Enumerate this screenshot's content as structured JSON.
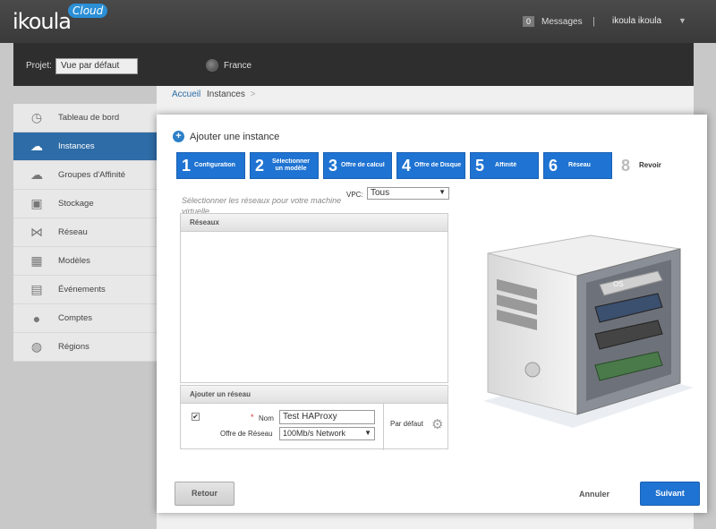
{
  "header": {
    "logo_text": "ikoula",
    "logo_cloud": "Cloud",
    "messages_count": "0",
    "messages_label": "Messages",
    "separator": "|",
    "user": "ikoula ikoula"
  },
  "project": {
    "label": "Projet:",
    "selected": "Vue par défaut",
    "zone": "France"
  },
  "breadcrumb": {
    "home": "Accueil",
    "current": "Instances",
    "arrow": ">"
  },
  "sidebar": {
    "items": [
      {
        "label": "Tableau de bord",
        "icon": "dashboard-icon"
      },
      {
        "label": "Instances",
        "icon": "cloud-icon",
        "active": true
      },
      {
        "label": "Groupes d'Affinité",
        "icon": "affinity-icon"
      },
      {
        "label": "Stockage",
        "icon": "storage-icon"
      },
      {
        "label": "Réseau",
        "icon": "network-icon"
      },
      {
        "label": "Modèles",
        "icon": "templates-icon"
      },
      {
        "label": "Événements",
        "icon": "calendar-icon"
      },
      {
        "label": "Comptes",
        "icon": "user-icon"
      },
      {
        "label": "Régions",
        "icon": "globe-icon"
      }
    ]
  },
  "modal": {
    "title": "Ajouter une instance",
    "steps": [
      {
        "num": "1",
        "label": "Configuration",
        "active": true
      },
      {
        "num": "2",
        "label": "Sélectionner un modèle",
        "active": true
      },
      {
        "num": "3",
        "label": "Offre de calcul",
        "active": true
      },
      {
        "num": "4",
        "label": "Offre de Disque",
        "active": true
      },
      {
        "num": "5",
        "label": "Affinité",
        "active": true
      },
      {
        "num": "6",
        "label": "Réseau",
        "active": true
      },
      {
        "num": "8",
        "label": "Revoir",
        "active": false
      }
    ],
    "network_hint": "Sélectionner les réseaux pour votre machine virtuelle",
    "vpc_label": "VPC:",
    "vpc_value": "Tous",
    "networks_header": "Réseaux",
    "add_network_header": "Ajouter un réseau",
    "name_required": "*",
    "name_label": "Nom",
    "name_value": "Test HAProxy",
    "offer_label": "Offre de Réseau",
    "offer_value": "100Mb/s Network",
    "default_label": "Par défaut",
    "pc_os_label": "OS",
    "back_button": "Retour",
    "cancel_button": "Annuler",
    "next_button": "Suivant"
  },
  "colors": {
    "accent": "#1f73d2",
    "sidebar_active": "#2d6ca6"
  }
}
